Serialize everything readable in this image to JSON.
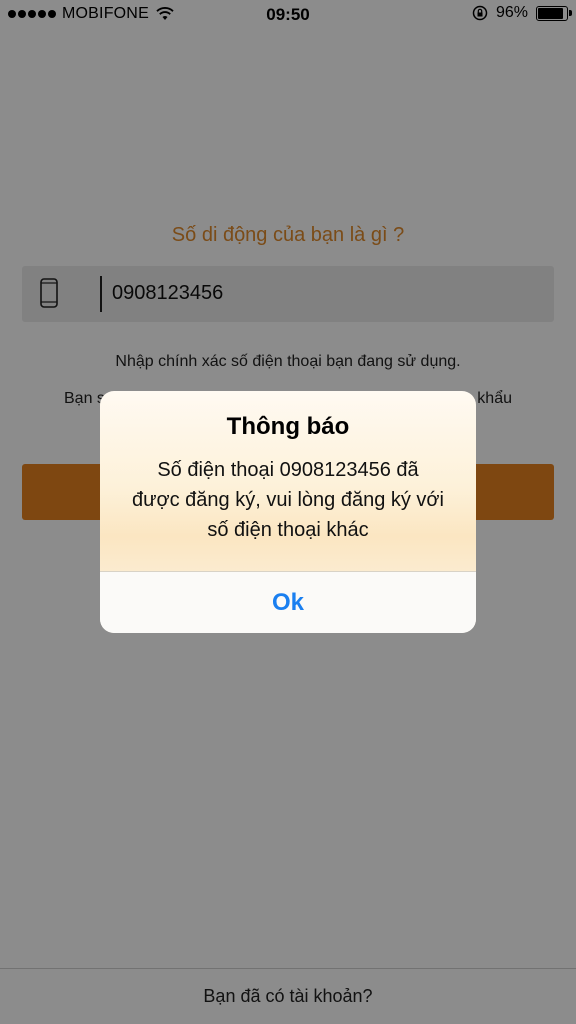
{
  "status_bar": {
    "carrier": "MOBIFONE",
    "time": "09:50",
    "battery": "96%",
    "battery_level": 0.96
  },
  "form": {
    "question": "Số di động của bạn là gì ?",
    "phone_value": "0908123456",
    "instruction": "Nhập chính xác số điện thoại bạn đang sử dụng.",
    "hint_left": "Bạn s",
    "hint_right": "khẩu",
    "login_link": "Bạn đã có tài khoản?"
  },
  "alert": {
    "title": "Thông báo",
    "message_line1": "Số điện thoại 0908123456 đã",
    "message_line2": "được đăng ký, vui lòng đăng ký với",
    "message_line3": "số điện thoại khác",
    "ok_label": "Ok"
  },
  "colors": {
    "accent": "#e08a2c",
    "button": "#e6821f",
    "alert_button_text": "#1a7ff0"
  }
}
